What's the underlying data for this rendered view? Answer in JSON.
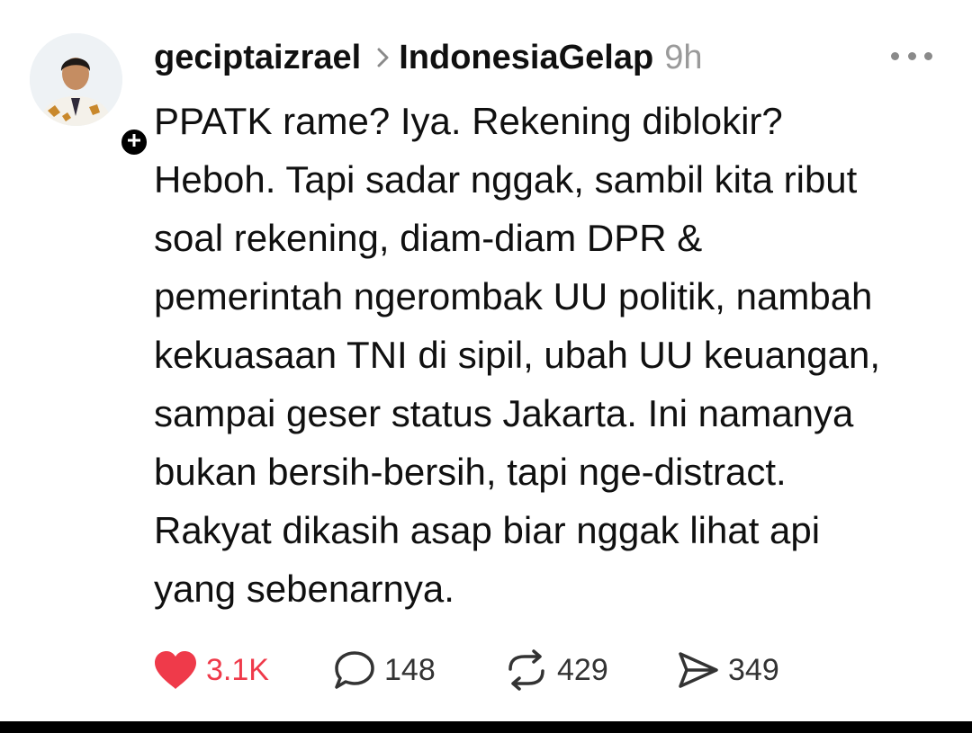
{
  "post": {
    "username": "geciptaizrael",
    "topic": "IndonesiaGelap",
    "time": "9h",
    "body_lines": [
      "PPATK rame? Iya. Rekening diblokir?",
      "Heboh. Tapi sadar nggak, sambil kita ribut",
      "soal rekening, diam-diam DPR &",
      "pemerintah ngerombak UU politik, nambah",
      "kekuasaan TNI di sipil, ubah UU keuangan,",
      "sampai geser status Jakarta. Ini namanya",
      "bukan bersih-bersih, tapi nge-distract.",
      "Rakyat dikasih asap biar nggak lihat api",
      "yang sebenarnya."
    ]
  },
  "actions": {
    "likes": "3.1K",
    "replies": "148",
    "reposts": "429",
    "shares": "349"
  },
  "icons": {
    "follow": "plus-icon",
    "separator": "chevron-right-icon",
    "more": "more-dots-icon",
    "like": "heart-icon",
    "reply": "comment-bubble-icon",
    "repost": "repost-icon",
    "share": "send-icon"
  },
  "colors": {
    "like_red": "#ef3a4a",
    "text": "#101010",
    "muted": "#9a9a9a"
  }
}
